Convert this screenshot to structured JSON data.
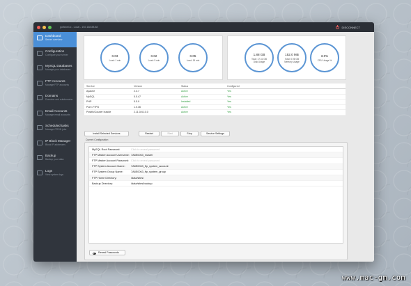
{
  "window": {
    "title": "golfanel.io - Local - 192.168.88.88",
    "disconnect_label": "DISCONNECT"
  },
  "sidebar": {
    "items": [
      {
        "label": "Dashboard",
        "sub": "Server overview",
        "icon": "dashboard-icon"
      },
      {
        "label": "Configuration",
        "sub": "Configure your server",
        "icon": "gear-icon"
      },
      {
        "label": "MySQL Databases",
        "sub": "Manage your databases",
        "icon": "database-icon"
      },
      {
        "label": "FTP Accounts",
        "sub": "Manage FTP accounts",
        "icon": "folder-icon"
      },
      {
        "label": "Domains",
        "sub": "Domains and subdomains",
        "icon": "globe-icon"
      },
      {
        "label": "Email Accounts",
        "sub": "Manage email accounts",
        "icon": "mail-icon"
      },
      {
        "label": "Scheduled tasks",
        "sub": "Manage CRON jobs",
        "icon": "clock-icon"
      },
      {
        "label": "IP Block Manager",
        "sub": "Block IP addresses",
        "icon": "shield-icon"
      },
      {
        "label": "Backup",
        "sub": "Backup your data",
        "icon": "backup-icon"
      },
      {
        "label": "Logs",
        "sub": "View system logs",
        "icon": "logs-icon"
      }
    ]
  },
  "load": [
    {
      "value": "0.03",
      "caption": "Load: 1 min"
    },
    {
      "value": "0.02",
      "caption": "Load: 5 min"
    },
    {
      "value": "0.05",
      "caption": "Load: 15 min"
    }
  ],
  "usage": [
    {
      "value": "1.88 GB",
      "caption": "Total: 17.41 GB\nDisk Usage"
    },
    {
      "value": "152.0 MB",
      "caption": "Total: 0.98 GB\nMemory Usage"
    },
    {
      "value": "3.0%",
      "caption": "CPU Usage %"
    }
  ],
  "services": {
    "headers": [
      "Service",
      "Version",
      "Status",
      "Configured"
    ],
    "rows": [
      [
        "Apache",
        "2.4.7",
        "Active",
        "Yes"
      ],
      [
        "MySQL",
        "5.5.47",
        "Active",
        "Yes"
      ],
      [
        "PHP",
        "5.5.9",
        "Installed",
        "Yes"
      ],
      [
        "Pure-FTPD",
        "1.0.36",
        "Active",
        "Yes"
      ],
      [
        "Postfix/Courier bundle",
        "2.11.0/4.10.0",
        "Active",
        "Yes"
      ]
    ]
  },
  "buttons": {
    "install": "Install Selected Services",
    "restart": "Restart",
    "start": "Start",
    "stop": "Stop",
    "settings": "Service Settings"
  },
  "config": {
    "title": "Current Configuration",
    "rows": [
      {
        "key": "MySQL Root Password:",
        "value": "Click to reveal password",
        "muted": true
      },
      {
        "key": "FTP Master Account Username:",
        "value": "7A8E0063_master",
        "muted": false
      },
      {
        "key": "FTP Master Account Password:",
        "value": "Click to reveal password",
        "muted": true
      },
      {
        "key": "FTP System Account Name:",
        "value": "7A8E0063_ftp_system_account",
        "muted": false
      },
      {
        "key": "FTP System Group Name:",
        "value": "7A8E0063_ftp_system_group",
        "muted": false
      },
      {
        "key": "FTP Home Directory:",
        "value": "/data/sites/",
        "muted": false
      },
      {
        "key": "Backup Directory:",
        "value": "/data/sites/backup",
        "muted": false
      }
    ],
    "reveal_label": "Reveal Passwords"
  },
  "watermark": "www.mac-gm.com"
}
